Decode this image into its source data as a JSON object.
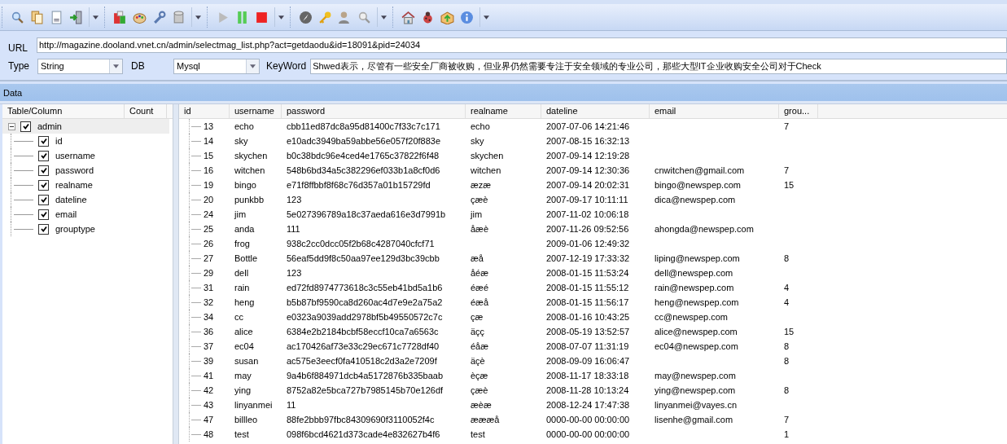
{
  "form": {
    "url_label": "URL",
    "url": "http://magazine.dooland.vnet.cn/admin/selectmag_list.php?act=getdaodu&id=18091&pid=24034",
    "type_label": "Type",
    "type": "String",
    "db_label": "DB",
    "db": "Mysql",
    "keyword_label": "KeyWord",
    "keyword": "Shwed表示，尽管有一些安全厂商被收购，但业界仍然需要专注于安全领域的专业公司，那些大型IT企业收购安全公司对于Check"
  },
  "data_panel": {
    "title": "Data"
  },
  "tree": {
    "columns": [
      "Table/Column",
      "Count"
    ],
    "items": [
      {
        "label": "admin",
        "checked": true,
        "expanded": true,
        "children": [
          {
            "label": "id",
            "checked": true
          },
          {
            "label": "username",
            "checked": true
          },
          {
            "label": "password",
            "checked": true
          },
          {
            "label": "realname",
            "checked": true
          },
          {
            "label": "dateline",
            "checked": true
          },
          {
            "label": "email",
            "checked": true
          },
          {
            "label": "grouptype",
            "checked": true
          }
        ]
      }
    ]
  },
  "table": {
    "columns": [
      "id",
      "username",
      "password",
      "realname",
      "dateline",
      "email",
      "grou..."
    ],
    "rows": [
      [
        "13",
        "echo",
        "cbb11ed87dc8a95d81400c7f33c7c171",
        "echo",
        "2007-07-06 14:21:46",
        "",
        "7"
      ],
      [
        "14",
        "sky",
        "e10adc3949ba59abbe56e057f20f883e",
        "sky",
        "2007-08-15 16:32:13",
        "",
        ""
      ],
      [
        "15",
        "skychen",
        "b0c38bdc96e4ced4e1765c37822f6f48",
        "skychen",
        "2007-09-14 12:19:28",
        "",
        ""
      ],
      [
        "16",
        "witchen",
        "548b6bd34a5c382296ef033b1a8cf0d6",
        "witchen",
        "2007-09-14 12:30:36",
        "cnwitchen@gmail.com",
        "7"
      ],
      [
        "19",
        "bingo",
        "e71f8ffbbf8f68c76d357a01b15729fd",
        "æzæ",
        "2007-09-14 20:02:31",
        "bingo@newspep.com",
        "15"
      ],
      [
        "20",
        "punkbb",
        "123",
        "çæè",
        "2007-09-17 10:11:11",
        "dica@newspep.com",
        ""
      ],
      [
        "24",
        "jim",
        "5e027396789a18c37aeda616e3d7991b",
        "jim",
        "2007-11-02 10:06:18",
        "",
        ""
      ],
      [
        "25",
        "anda",
        "111",
        "åæè",
        "2007-11-26 09:52:56",
        "ahongda@newspep.com",
        ""
      ],
      [
        "26",
        "frog",
        "938c2cc0dcc05f2b68c4287040cfcf71",
        "",
        "2009-01-06 12:49:32",
        "",
        ""
      ],
      [
        "27",
        "Bottle",
        "56eaf5dd9f8c50aa97ee129d3bc39cbb",
        "æå",
        "2007-12-19 17:33:32",
        "liping@newspep.com",
        "8"
      ],
      [
        "29",
        "dell",
        "123",
        "åéæ",
        "2008-01-15 11:53:24",
        "dell@newspep.com",
        ""
      ],
      [
        "31",
        "rain",
        "ed72fd8974773618c3c55eb41bd5a1b6",
        "éæé",
        "2008-01-15 11:55:12",
        "rain@newspep.com",
        "4"
      ],
      [
        "32",
        "heng",
        "b5b87bf9590ca8d260ac4d7e9e2a75a2",
        "éæå",
        "2008-01-15 11:56:17",
        "heng@newspep.com",
        "4"
      ],
      [
        "34",
        "cc",
        "e0323a9039add2978bf5b49550572c7c",
        "çæ",
        "2008-01-16 10:43:25",
        "cc@newspep.com",
        ""
      ],
      [
        "36",
        "alice",
        "6384e2b2184bcbf58eccf10ca7a6563c",
        "äçç",
        "2008-05-19 13:52:57",
        "alice@newspep.com",
        "15"
      ],
      [
        "37",
        "ec04",
        "ac170426af73e33c29ec671c7728df40",
        "éåæ",
        "2008-07-07 11:31:19",
        "ec04@newspep.com",
        "8"
      ],
      [
        "39",
        "susan",
        "ac575e3eecf0fa410518c2d3a2e7209f",
        "äçè",
        "2008-09-09 16:06:47",
        "",
        "8"
      ],
      [
        "41",
        "may",
        "9a4b6f884971dcb4a5172876b335baab",
        "èçæ",
        "2008-11-17 18:33:18",
        "may@newspep.com",
        ""
      ],
      [
        "42",
        "ying",
        "8752a82e5bca727b7985145b70e126df",
        "çæè",
        "2008-11-28 10:13:24",
        "ying@newspep.com",
        "8"
      ],
      [
        "43",
        "linyanmei",
        "11",
        "æèæ",
        "2008-12-24 17:47:38",
        "linyanmei@vayes.cn",
        ""
      ],
      [
        "47",
        "billleo",
        "88fe2bbb97fbc84309690f3110052f4c",
        "æææå",
        "0000-00-00 00:00:00",
        "lisenhe@gmail.com",
        "7"
      ],
      [
        "48",
        "test",
        "098f6bcd4621d373cade4e832627b4f6",
        "test",
        "0000-00-00 00:00:00",
        "",
        "1"
      ]
    ]
  }
}
